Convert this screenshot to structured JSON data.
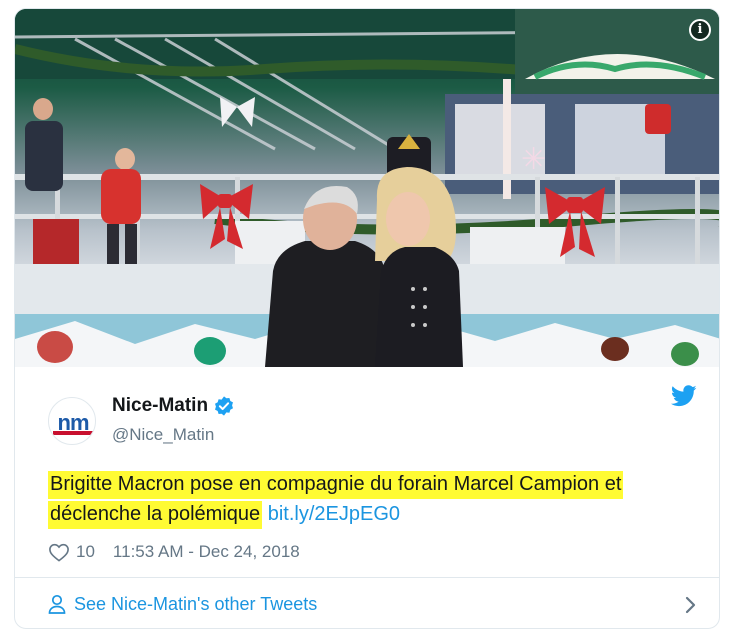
{
  "tweet": {
    "display_name": "Nice-Matin",
    "handle": "@Nice_Matin",
    "avatar_text": "nm",
    "text_part1": "Brigitte Macron pose en compagnie du forain Marcel Campion et",
    "text_part2": "déclenche la polémique",
    "link_text": "bit.ly/2EJpEG0",
    "likes": "10",
    "timestamp": "11:53 AM - Dec 24, 2018",
    "footer_link": "See Nice-Matin's other Tweets",
    "verified": true
  },
  "icons": {
    "info": "info-icon",
    "verified": "verified-badge-icon",
    "twitter": "twitter-bird-icon",
    "heart": "heart-icon",
    "person": "person-icon",
    "chevron": "chevron-right-icon"
  },
  "colors": {
    "link": "#1b95e0",
    "twitter_blue": "#1da1f2",
    "highlight": "#fffb33",
    "muted": "#657786",
    "text": "#14171a"
  }
}
